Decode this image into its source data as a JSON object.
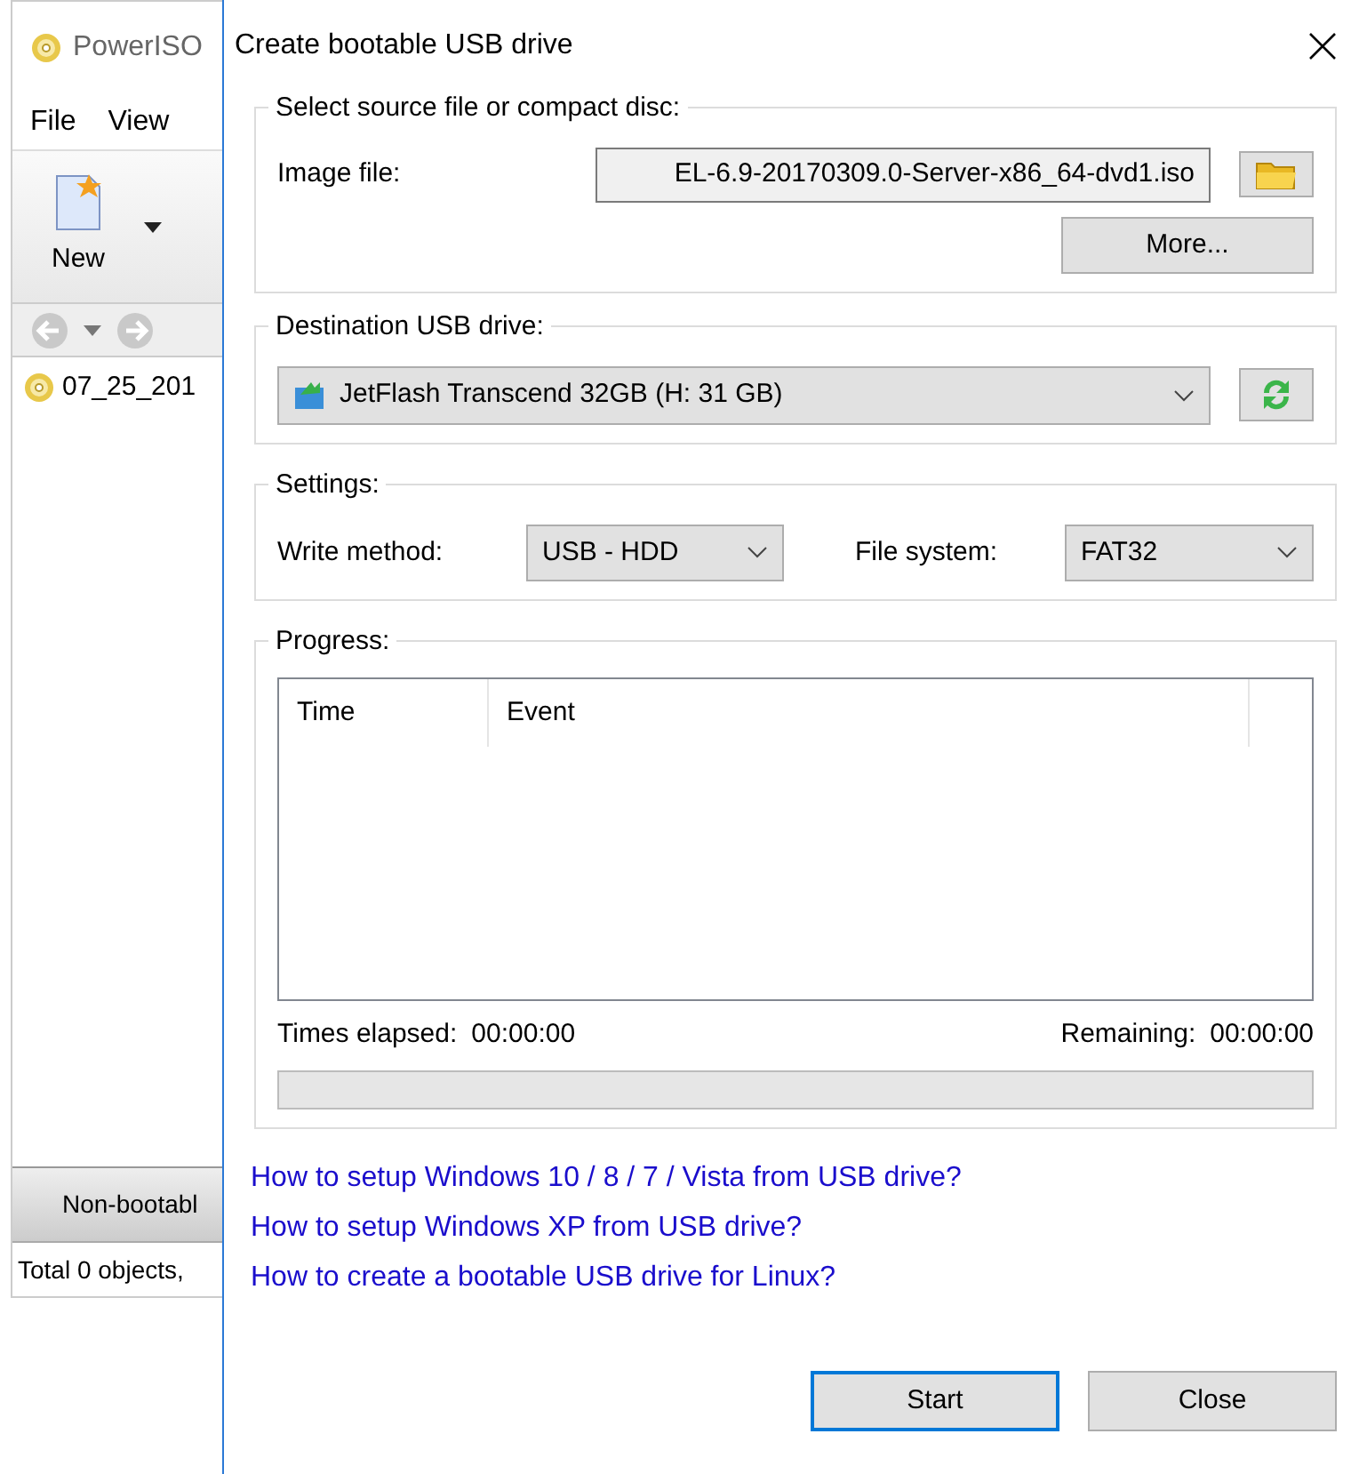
{
  "background_window": {
    "title": "PowerISO",
    "menu": [
      "File",
      "View"
    ],
    "toolbar": [
      {
        "label": "New"
      }
    ],
    "files": [
      {
        "name": "07_25_201"
      }
    ],
    "boot_status": "Non-bootabl",
    "status_bar": "Total 0 objects,"
  },
  "dialog": {
    "title": "Create bootable USB drive",
    "source": {
      "legend": "Select source file or compact disc:",
      "label": "Image file:",
      "value": "EL-6.9-20170309.0-Server-x86_64-dvd1.iso",
      "more_button": "More..."
    },
    "destination": {
      "legend": "Destination USB drive:",
      "selected": "JetFlash Transcend 32GB (H: 31 GB)"
    },
    "settings": {
      "legend": "Settings:",
      "fields": [
        {
          "label": "Write method:",
          "value": "USB - HDD"
        },
        {
          "label": "File system:",
          "value": "FAT32"
        }
      ]
    },
    "progress": {
      "legend": "Progress:",
      "columns": [
        "Time",
        "Event"
      ],
      "elapsed_label": "Times elapsed:",
      "elapsed": "00:00:00",
      "remaining_label": "Remaining:",
      "remaining": "00:00:00",
      "level": 0
    },
    "links": [
      "How to setup Windows 10 / 8 / 7 / Vista from USB drive?",
      "How to setup Windows XP from USB drive?",
      "How to create a bootable USB drive for Linux?"
    ],
    "buttons": [
      {
        "label": "Start",
        "default": true
      },
      {
        "label": "Close",
        "default": false
      }
    ]
  }
}
